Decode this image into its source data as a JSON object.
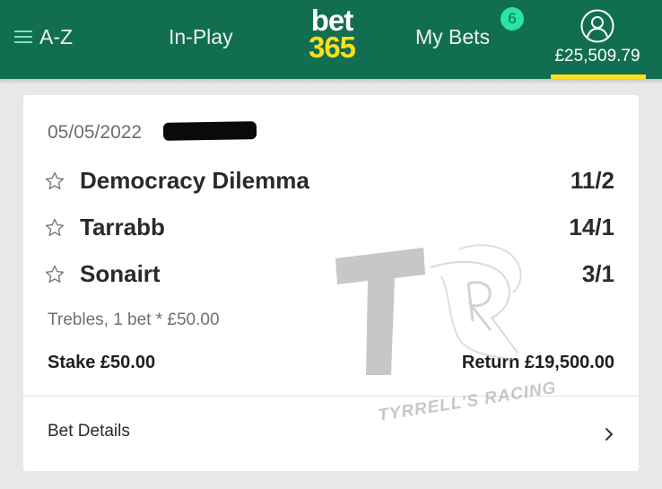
{
  "header": {
    "menu_label": "A-Z",
    "inplay_label": "In-Play",
    "logo_top": "bet",
    "logo_bottom": "365",
    "mybets_label": "My Bets",
    "mybets_badge": "6",
    "balance": "£25,509.79",
    "icons": {
      "menu": "hamburger-icon",
      "account": "user-icon"
    },
    "colors": {
      "brand_green": "#126e51",
      "brand_yellow": "#ffdf1b",
      "badge": "#27e6a2"
    }
  },
  "bet": {
    "date": "05/05/2022",
    "selections": [
      {
        "name": "Democracy Dilemma",
        "odds": "11/2"
      },
      {
        "name": "Tarrabb",
        "odds": "14/1"
      },
      {
        "name": "Sonairt",
        "odds": "3/1"
      }
    ],
    "bet_type": "Trebles, 1 bet * £50.00",
    "stake": "Stake £50.00",
    "return": "Return £19,500.00",
    "details_label": "Bet Details"
  },
  "watermark": {
    "text": "TYRRELL'S RACING"
  }
}
